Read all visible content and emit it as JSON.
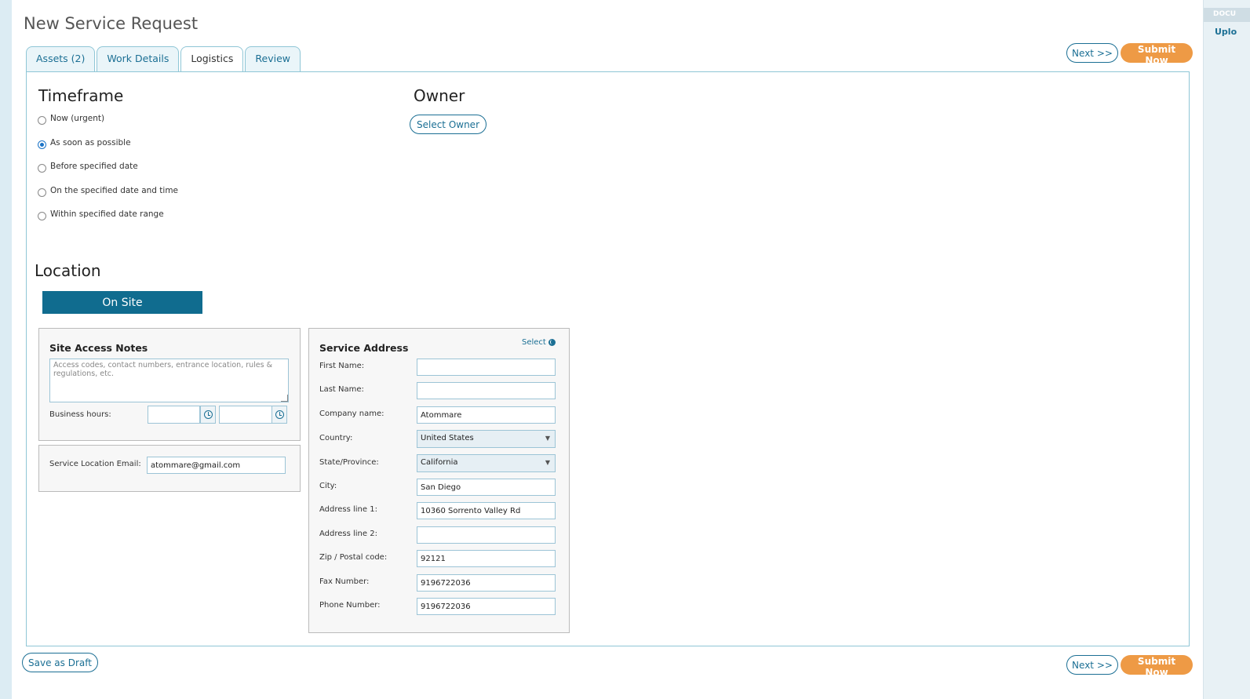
{
  "page": {
    "title": "New Service Request"
  },
  "tabs": [
    {
      "label": "Assets (2)",
      "active": false
    },
    {
      "label": "Work Details",
      "active": false
    },
    {
      "label": "Logistics",
      "active": true
    },
    {
      "label": "Review",
      "active": false
    }
  ],
  "actions": {
    "next_label": "Next >>",
    "submit_label": "Submit Now",
    "save_draft_label": "Save as Draft"
  },
  "right_panel": {
    "header": "DOCU",
    "link": "Uplo"
  },
  "timeframe": {
    "heading": "Timeframe",
    "selected_index": 1,
    "options": [
      "Now (urgent)",
      "As soon as possible",
      "Before specified date",
      "On the specified date and time",
      "Within specified date range"
    ]
  },
  "owner": {
    "heading": "Owner",
    "select_label": "Select Owner"
  },
  "location": {
    "heading": "Location",
    "mode_label": "On Site",
    "site_access": {
      "title": "Site Access Notes",
      "notes_placeholder": "Access codes, contact numbers, entrance location, rules & regulations, etc.",
      "notes_value": "",
      "business_hours_label": "Business hours:",
      "hours_from": "",
      "hours_to": ""
    },
    "email": {
      "label": "Service Location Email:",
      "value": "atommare@gmail.com"
    },
    "service_address": {
      "title": "Service Address",
      "select_label": "Select",
      "fields": {
        "first_name": {
          "label": "First Name:",
          "value": ""
        },
        "last_name": {
          "label": "Last Name:",
          "value": ""
        },
        "company_name": {
          "label": "Company name:",
          "value": "Atommare"
        },
        "country": {
          "label": "Country:",
          "value": "United States"
        },
        "state": {
          "label": "State/Province:",
          "value": "California"
        },
        "city": {
          "label": "City:",
          "value": "San Diego"
        },
        "address1": {
          "label": "Address line 1:",
          "value": "10360 Sorrento Valley Rd"
        },
        "address2": {
          "label": "Address line 2:",
          "value": ""
        },
        "zip": {
          "label": "Zip / Postal code:",
          "value": "92121"
        },
        "fax": {
          "label": "Fax Number:",
          "value": "9196722036"
        },
        "phone": {
          "label": "Phone Number:",
          "value": "9196722036"
        }
      }
    }
  },
  "colors": {
    "accent": "#1b6f94",
    "orange": "#ee9a45",
    "onsite": "#106c8f",
    "border": "#8fc6d6"
  }
}
